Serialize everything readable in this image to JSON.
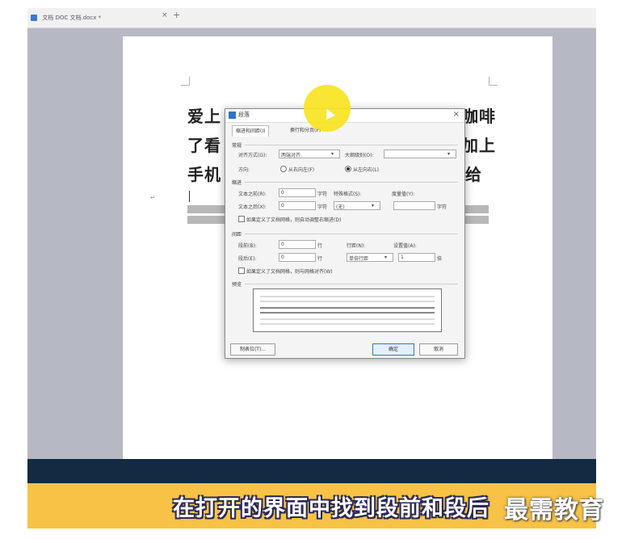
{
  "tab": {
    "title": "文档 DOC 文档.docx *",
    "close": "×",
    "add": "+"
  },
  "document": {
    "line1_left": "爱上",
    "line1_right": "咖啡",
    "line2_left": "了看",
    "line2_right": "加上",
    "line3_left": "手机",
    "line3_right": "给",
    "para_mark": "↵"
  },
  "dialog": {
    "title": "段落",
    "close": "×",
    "tabs": [
      "缩进和间距(I)",
      "换行和分页(P)"
    ],
    "general": {
      "section": "常规",
      "align_label": "对齐方式(G):",
      "align_value": "两端对齐",
      "outline_label": "大纲级别(O):",
      "outline_value": "",
      "direction_label": "方向:",
      "rtl": "从右向左(F)",
      "ltr": "从左向右(L)"
    },
    "indent": {
      "section": "缩进",
      "before_text": "文本之前(R):",
      "before_value": "0",
      "after_text": "文本之后(X):",
      "after_value": "0",
      "unit": "字符",
      "special_label": "特殊格式(S):",
      "special_value": "(无)",
      "measure_label": "度量值(Y):",
      "measure_unit": "字符",
      "grid_check": "如果定义了文档网格，则自动调整右缩进(D)"
    },
    "spacing": {
      "section": "间距",
      "before_label": "段前(B):",
      "before_value": "0",
      "before_unit": "行",
      "after_label": "段后(E):",
      "after_value": "0",
      "after_unit": "行",
      "line_label": "行距(N):",
      "line_value": "单倍行距",
      "setval_label": "设置值(A):",
      "setval_value": "1",
      "setval_unit": "倍",
      "grid_check": "如果定义了文档网格，则与网格对齐(W)"
    },
    "preview_label": "预览",
    "buttons": {
      "tabs": "制表位(T)...",
      "ok": "确定",
      "cancel": "取消"
    }
  },
  "caption": "在打开的界面中找到段前和段后",
  "logo": "最需教育"
}
